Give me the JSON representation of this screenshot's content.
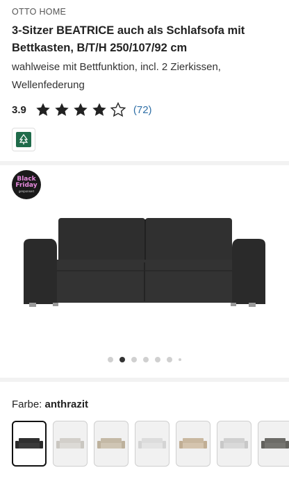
{
  "product": {
    "brand": "OTTO HOME",
    "title": "3-Sitzer BEATRICE auch als Schlafsofa mit Bettkasten, B/T/H 250/107/92 cm",
    "subtitle": "wahlweise mit Bettfunktion, incl. 2 Zierkissen, Wellenfederung"
  },
  "rating": {
    "value": "3.9",
    "count": "(72)",
    "stars_filled": 4,
    "stars_total": 5
  },
  "badges": {
    "fsc_icon": "fsc-tree-icon",
    "black_friday": [
      "Black",
      "Friday"
    ],
    "black_friday_sub": "gesponsert"
  },
  "gallery": {
    "image_count": 7,
    "active_index": 1
  },
  "color": {
    "label": "Farbe:",
    "selected": "anthrazit",
    "swatch_colors": [
      "#3a3a3a",
      "#dcdad6",
      "#cfc5b4",
      "#e4e4e4",
      "#d4c4ae",
      "#d9d9d9",
      "#757470"
    ]
  },
  "colors": {
    "text": "#222222",
    "link": "#2f6fa6",
    "fsc_green": "#1f6b4a",
    "black_friday_pink": "#e98be0"
  }
}
